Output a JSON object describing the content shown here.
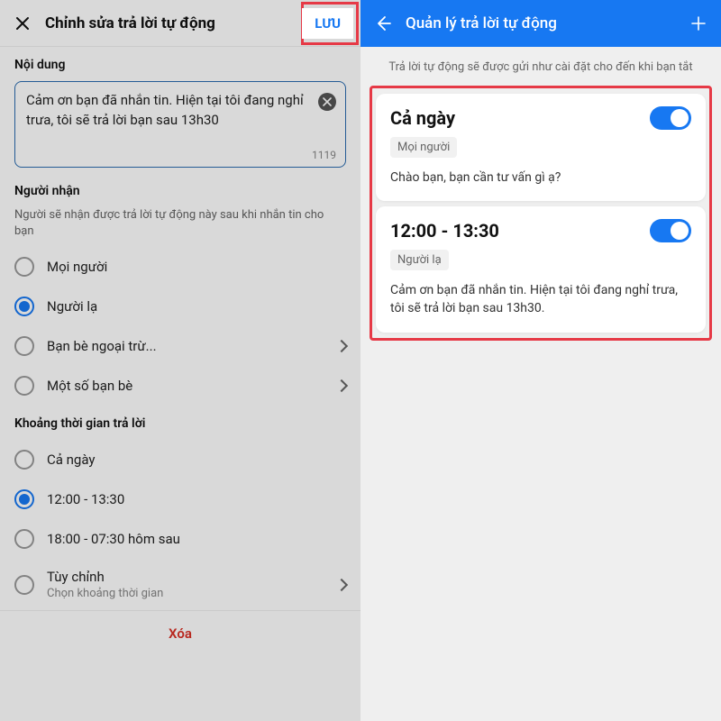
{
  "left": {
    "title": "Chỉnh sửa trả lời tự động",
    "save": "LƯU",
    "content_label": "Nội dung",
    "textarea_value": "Cảm ơn bạn đã nhắn tin. Hiện tại tôi đang nghỉ trưa, tôi sẽ trả lời bạn sau 13h30",
    "char_count": "1119",
    "recipient_label": "Người nhận",
    "recipient_desc": "Người sẽ nhận được trả lời tự động này sau khi nhắn tin cho bạn",
    "recipients": [
      {
        "label": "Mọi người",
        "selected": false,
        "chevron": false
      },
      {
        "label": "Người lạ",
        "selected": true,
        "chevron": false
      },
      {
        "label": "Bạn bè ngoại trừ...",
        "selected": false,
        "chevron": true
      },
      {
        "label": "Một số bạn bè",
        "selected": false,
        "chevron": true
      }
    ],
    "time_label": "Khoảng thời gian trả lời",
    "times": [
      {
        "label": "Cả ngày",
        "selected": false,
        "chevron": false,
        "sub": ""
      },
      {
        "label": "12:00 - 13:30",
        "selected": true,
        "chevron": false,
        "sub": ""
      },
      {
        "label": "18:00 - 07:30 hôm sau",
        "selected": false,
        "chevron": false,
        "sub": ""
      },
      {
        "label": "Tùy chỉnh",
        "selected": false,
        "chevron": true,
        "sub": "Chọn khoảng thời gian"
      }
    ],
    "delete": "Xóa"
  },
  "right": {
    "title": "Quản lý trả lời tự động",
    "desc": "Trả lời tự động sẽ được gửi như cài đặt cho đến khi bạn tắt",
    "cards": [
      {
        "title": "Cả ngày",
        "tag": "Mọi người",
        "body": "Chào bạn, bạn cần tư vấn gì ạ?",
        "enabled": true
      },
      {
        "title": "12:00 - 13:30",
        "tag": "Người lạ",
        "body": "Cảm ơn bạn đã nhắn tin. Hiện tại tôi đang nghỉ trưa, tôi sẽ trả lời bạn sau 13h30.",
        "enabled": true
      }
    ]
  }
}
